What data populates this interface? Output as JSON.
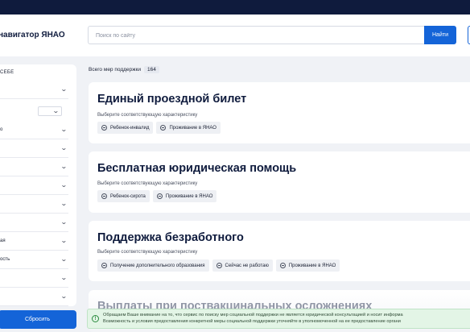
{
  "header": {
    "title": "навигатор ЯНАО",
    "search_placeholder": "Поиск по сайту",
    "search_button": "Найти"
  },
  "sidebar": {
    "heading": "СЕБЕ",
    "rows": [
      {
        "label": ""
      },
      {
        "label": ""
      },
      {
        "label": "о"
      },
      {
        "label": ""
      },
      {
        "label": ""
      },
      {
        "label": ""
      },
      {
        "label": ""
      },
      {
        "label": ""
      },
      {
        "label": "ая"
      },
      {
        "label": "ость"
      },
      {
        "label": ""
      },
      {
        "label": ""
      }
    ],
    "reset_button": "Сбросить"
  },
  "results": {
    "total_label": "Всего мер поддержки",
    "total_count": "164"
  },
  "cards": [
    {
      "title": "Единый проездной билет",
      "hint": "Выберите соответствующую характеристику",
      "tags": [
        "Ребенок-инвалид",
        "Проживание в ЯНАО"
      ]
    },
    {
      "title": "Бесплатная юридическая помощь",
      "hint": "Выберите соответствующую характеристику",
      "tags": [
        "Ребенок-сирота",
        "Проживание в ЯНАО"
      ]
    },
    {
      "title": "Поддержка безработного",
      "hint": "Выберите соответствующую характеристику",
      "tags": [
        "Получение дополнительного образования",
        "Сейчас не работаю",
        "Проживание в ЯНАО"
      ]
    }
  ],
  "partial_card": {
    "title": "Выплаты при поствакцинальных осложнениях"
  },
  "notice": {
    "line1": "Обращаем Ваше внимание на то, что сервис по поиску мер социальной поддержки не является юридической консультацией и носит информа",
    "line2": "Возможность и условия предоставления конкретной меры социальной поддержки уточняйте в уполномоченной на ее предоставление органи"
  },
  "colors": {
    "topbar": "#0f1b3d",
    "primary": "#1464d8",
    "notice_bg": "#e3f5e6"
  }
}
